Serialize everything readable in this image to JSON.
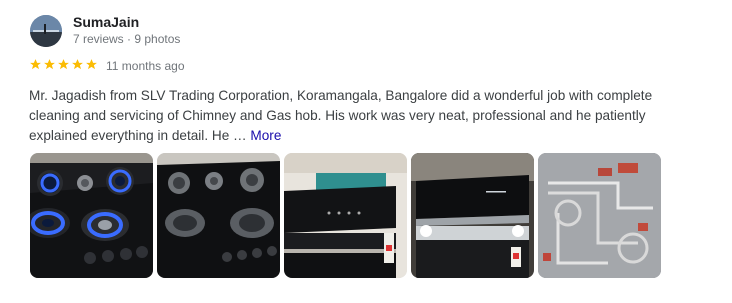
{
  "reviewer": {
    "name": "SumaJain",
    "meta": "7 reviews · 9 photos"
  },
  "rating": {
    "stars": 5,
    "max": 5,
    "color": "#fbbc04"
  },
  "time_ago": "11 months ago",
  "review_text": "Mr. Jagadish from SLV Trading Corporation, Koramangala, Bangalore did a wonderful job with complete cleaning and servicing of Chimney and Gas hob. His work was very neat, professional and he patiently explained everything in detail. He …",
  "more_label": "More",
  "photos": [
    {
      "subject": "gas-hob-flames"
    },
    {
      "subject": "gas-hob-clean"
    },
    {
      "subject": "chimney-off"
    },
    {
      "subject": "chimney-lit"
    },
    {
      "subject": "hob-internals"
    }
  ],
  "colors": {
    "link": "#1a0dab",
    "secondary_text": "#70757a"
  }
}
